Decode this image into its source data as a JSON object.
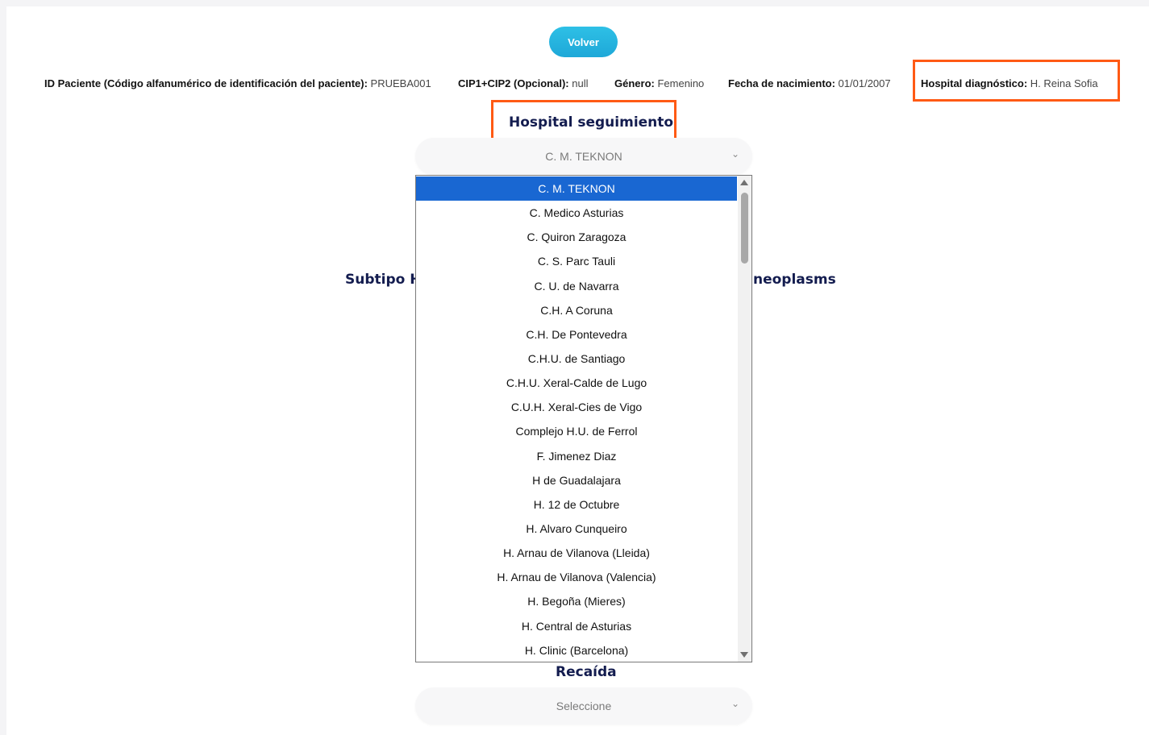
{
  "back_button": "Volver",
  "patient_info": {
    "id_label": "ID Paciente (Código alfanumérico de identificación del paciente):",
    "id_value": "PRUEBA001",
    "cip_label": "CIP1+CIP2 (Opcional):",
    "cip_value": "null",
    "gender_label": "Género:",
    "gender_value": "Femenino",
    "dob_label": "Fecha de nacimiento:",
    "dob_value": "01/01/2007",
    "hospital_dx_label": "Hospital diagnóstico:",
    "hospital_dx_value": "H. Reina Sofia"
  },
  "follow_up": {
    "title": "Hospital seguimiento",
    "selected_value": "C. M. TEKNON",
    "options": [
      "C. M. TEKNON",
      "C. Medico Asturias",
      "C. Quiron Zaragoza",
      "C. S. Parc Tauli",
      "C. U. de Navarra",
      "C.H. A Coruna",
      "C.H. De Pontevedra",
      "C.H.U. de Santiago",
      "C.H.U. Xeral-Calde de Lugo",
      "C.U.H. Xeral-Cies de Vigo",
      "Complejo H.U. de Ferrol",
      "F. Jimenez Diaz",
      "H de Guadalajara",
      "H. 12 de Octubre",
      "H. Alvaro Cunqueiro",
      "H. Arnau de Vilanova (Lleida)",
      "H. Arnau de Vilanova (Valencia)",
      "H. Begoña (Mieres)",
      "H. Central de Asturias",
      "H. Clinic (Barcelona)"
    ]
  },
  "hidden_section": {
    "left_fragment": "Subtipo H",
    "right_fragment": "neoplasms"
  },
  "relapse": {
    "title": "Recaída",
    "placeholder": "Seleccione"
  },
  "colors": {
    "highlight": "#ff5a14",
    "title": "#131c4f",
    "selected_option": "#1967d2",
    "button": "#1ea8d8"
  }
}
